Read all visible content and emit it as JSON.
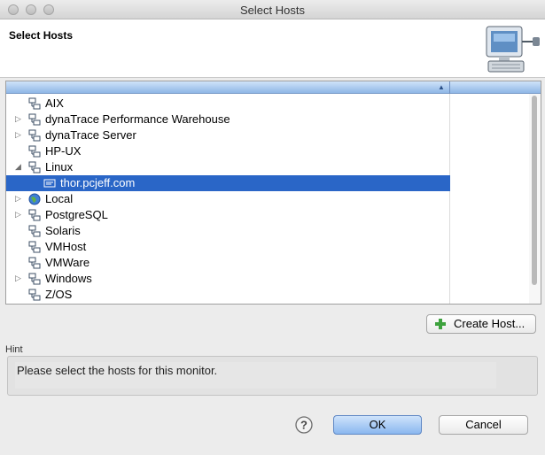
{
  "window": {
    "title": "Select Hosts"
  },
  "banner": {
    "title": "Select Hosts",
    "icon": "computer-icon"
  },
  "tree": {
    "sort_indicator": "▲",
    "rows": [
      {
        "label": "AIX",
        "icon": "host-group-icon",
        "expandable": false,
        "expanded": false,
        "level": 0,
        "selected": false
      },
      {
        "label": "dynaTrace Performance Warehouse",
        "icon": "host-group-icon",
        "expandable": true,
        "expanded": false,
        "level": 0,
        "selected": false
      },
      {
        "label": "dynaTrace Server",
        "icon": "host-group-icon",
        "expandable": true,
        "expanded": false,
        "level": 0,
        "selected": false
      },
      {
        "label": "HP-UX",
        "icon": "host-group-icon",
        "expandable": false,
        "expanded": false,
        "level": 0,
        "selected": false
      },
      {
        "label": "Linux",
        "icon": "host-group-icon",
        "expandable": true,
        "expanded": true,
        "level": 0,
        "selected": false
      },
      {
        "label": "thor.pcjeff.com",
        "icon": "host-icon",
        "expandable": false,
        "expanded": false,
        "level": 1,
        "selected": true
      },
      {
        "label": "Local",
        "icon": "globe-icon",
        "expandable": true,
        "expanded": false,
        "level": 0,
        "selected": false
      },
      {
        "label": "PostgreSQL",
        "icon": "host-group-icon",
        "expandable": true,
        "expanded": false,
        "level": 0,
        "selected": false
      },
      {
        "label": "Solaris",
        "icon": "host-group-icon",
        "expandable": false,
        "expanded": false,
        "level": 0,
        "selected": false
      },
      {
        "label": "VMHost",
        "icon": "host-group-icon",
        "expandable": false,
        "expanded": false,
        "level": 0,
        "selected": false
      },
      {
        "label": "VMWare",
        "icon": "host-group-icon",
        "expandable": false,
        "expanded": false,
        "level": 0,
        "selected": false
      },
      {
        "label": "Windows",
        "icon": "host-group-icon",
        "expandable": true,
        "expanded": false,
        "level": 0,
        "selected": false
      },
      {
        "label": "Z/OS",
        "icon": "host-group-icon",
        "expandable": false,
        "expanded": false,
        "level": 0,
        "selected": false
      }
    ]
  },
  "actions": {
    "create_host_label": "Create Host..."
  },
  "hint": {
    "label": "Hint",
    "text": "Please select the hosts for this monitor."
  },
  "footer": {
    "help_icon": "help-icon",
    "ok_label": "OK",
    "cancel_label": "Cancel"
  },
  "colors": {
    "selection": "#2a66c7",
    "header_blue": "#8fb6e6",
    "ok_blue": "#8ab7ef"
  }
}
